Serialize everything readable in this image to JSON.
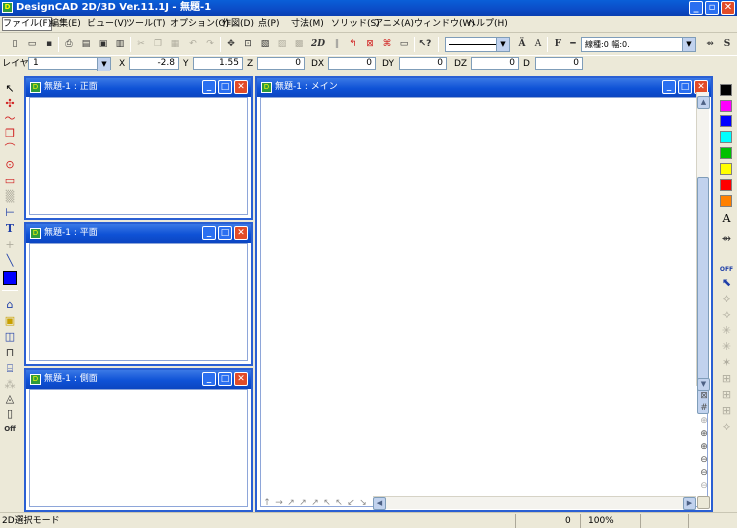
{
  "app": {
    "title": "DesignCAD 2D/3D Ver.11.1J - 無題-1",
    "icon_name": "designcad-icon"
  },
  "menus": [
    "ファイル(F)",
    "編集(E)",
    "ビュー(V)",
    "ツール(T)",
    "オプション(O)",
    "作図(D)",
    "点(P)",
    "寸法(M)",
    "ソリッド(S)",
    "アニメ(A)",
    "ウィンドウ(W)",
    "ヘルプ(H)"
  ],
  "toolbar": {
    "label_2d": "2D",
    "style_text": "A",
    "font_label": "F",
    "line_type": "線種:0 幅:0.",
    "icons": [
      "new-icon",
      "open-icon",
      "save-icon",
      "print-icon",
      "print-preview-icon",
      "page-setup-icon",
      "cut-icon",
      "copy-icon",
      "paste-icon",
      "undo-icon",
      "redo-icon",
      "snap-icon",
      "zoom-icon",
      "help-icon"
    ]
  },
  "coords": {
    "layer_label": "レイヤー",
    "layer_value": "1",
    "x_label": "X",
    "x_value": "-2.8",
    "y_label": "Y",
    "y_value": "1.55",
    "z_label": "Z",
    "z_value": "0",
    "dx_label": "DX",
    "dx_value": "0",
    "dy_label": "DY",
    "dy_value": "0",
    "dz_label": "DZ",
    "dz_value": "0",
    "d_label": "D",
    "d_value": "0"
  },
  "windows": {
    "front": {
      "title": "無題-1 : 正面"
    },
    "top": {
      "title": "無題-1 : 平面"
    },
    "side": {
      "title": "無題-1 : 側面"
    },
    "main": {
      "title": "無題-1 : メイン"
    }
  },
  "palette": {
    "colors": [
      "#000000",
      "#ff00ff",
      "#0000ff",
      "#00ffff",
      "#00c000",
      "#ffff00",
      "#ff0000",
      "#ff8000"
    ],
    "text_tool": "A",
    "off_label": "OFF",
    "current_color": "#0000ff"
  },
  "status": {
    "mode": "2D選択モード",
    "count": "0",
    "zoom": "100%"
  }
}
